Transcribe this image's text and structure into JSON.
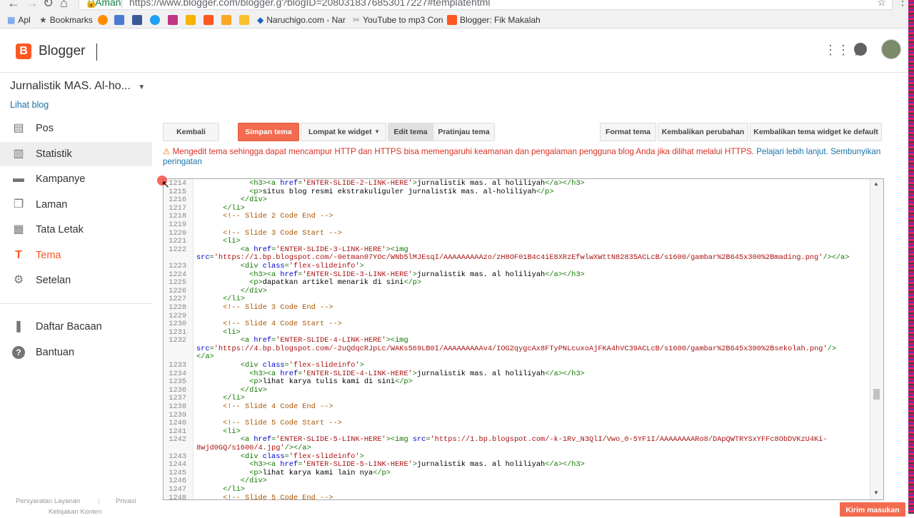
{
  "browser": {
    "url_secure": "Aman",
    "url": "https://www.blogger.com/blogger.g?blogID=2080318376853017227#templatehtml",
    "bookmarks": [
      "Apl",
      "Bookmarks",
      "Naruchigo.com - Nar",
      "YouTube to mp3 Con",
      "Blogger: Fik Makalah"
    ]
  },
  "header": {
    "app_name": "Blogger"
  },
  "sidebar": {
    "blog_title": "Jurnalistik MAS. Al-ho...",
    "view_blog": "Lihat blog",
    "items": [
      {
        "label": "Pos",
        "icon": "posts-icon",
        "glyph": "▤"
      },
      {
        "label": "Statistik",
        "icon": "stats-icon",
        "glyph": "▥"
      },
      {
        "label": "Kampanye",
        "icon": "campaign-icon",
        "glyph": "▬"
      },
      {
        "label": "Laman",
        "icon": "pages-icon",
        "glyph": "❐"
      },
      {
        "label": "Tata Letak",
        "icon": "layout-icon",
        "glyph": "▦"
      },
      {
        "label": "Tema",
        "icon": "theme-icon",
        "glyph": "T",
        "active": true
      },
      {
        "label": "Setelan",
        "icon": "settings-icon",
        "glyph": "⚙"
      }
    ],
    "items2": [
      {
        "label": "Daftar Bacaan",
        "icon": "bookmark-icon",
        "glyph": "❚"
      },
      {
        "label": "Bantuan",
        "icon": "help-icon",
        "glyph": "?"
      }
    ],
    "footer_terms": "Persyaratan Layanan",
    "footer_privacy": "Privasi",
    "footer_content": "Kebijakan Konten"
  },
  "toolbar": {
    "back": "Kembali",
    "save": "Simpan tema",
    "jump": "Lompat ke widget",
    "edit": "Edit tema",
    "preview": "Pratinjau tema",
    "format": "Format tema",
    "revert": "Kembalikan perubahan",
    "revert_default": "Kembalikan tema widget ke default"
  },
  "warning": {
    "text": "Mengedit tema sehingga dapat mencampur HTTP dan HTTPS bisa memengaruhi keamanan dan pengalaman pengguna blog Anda jika dilihat melalui HTTPS.",
    "learn_more": "Pelajari lebih lanjut.",
    "hide": "Sembunyikan",
    "hide2": "peringatan"
  },
  "feedback": "Kirim masukan",
  "code": [
    {
      "n": "1214",
      "segs": [
        [
          "t",
          "            "
        ],
        [
          "tag",
          "<h3><a "
        ],
        [
          "attr",
          "href"
        ],
        [
          "tag",
          "="
        ],
        [
          "str",
          "'ENTER-SLIDE-2-LINK-HERE'"
        ],
        [
          "tag",
          ">"
        ],
        [
          "t",
          "jurnalistik mas. al holiliyah"
        ],
        [
          "tag",
          "</a></h3>"
        ]
      ]
    },
    {
      "n": "1215",
      "segs": [
        [
          "t",
          "            "
        ],
        [
          "tag",
          "<p>"
        ],
        [
          "t",
          "situs blog resmi ekstrakuliguler jurnalistik mas. al-holiliyah"
        ],
        [
          "tag",
          "</p>"
        ]
      ]
    },
    {
      "n": "1216",
      "segs": [
        [
          "t",
          "          "
        ],
        [
          "tag",
          "</div>"
        ]
      ]
    },
    {
      "n": "1217",
      "segs": [
        [
          "t",
          "      "
        ],
        [
          "tag",
          "</li>"
        ]
      ]
    },
    {
      "n": "1218",
      "segs": [
        [
          "t",
          "      "
        ],
        [
          "com",
          "<!-- Slide 2 Code End -->"
        ]
      ]
    },
    {
      "n": "1219",
      "segs": []
    },
    {
      "n": "1220",
      "segs": [
        [
          "t",
          "      "
        ],
        [
          "com",
          "<!-- Slide 3 Code Start -->"
        ]
      ]
    },
    {
      "n": "1221",
      "segs": [
        [
          "t",
          "      "
        ],
        [
          "tag",
          "<li>"
        ]
      ]
    },
    {
      "n": "1222",
      "segs": [
        [
          "t",
          "          "
        ],
        [
          "tag",
          "<a "
        ],
        [
          "attr",
          "href"
        ],
        [
          "tag",
          "="
        ],
        [
          "str",
          "'ENTER-SLIDE-3-LINK-HERE'"
        ],
        [
          "tag",
          "><img"
        ]
      ]
    },
    {
      "n": "",
      "segs": [
        [
          "attr",
          "src"
        ],
        [
          "tag",
          "="
        ],
        [
          "str",
          "'https://1.bp.blogspot.com/-0etman07YOc/WNb5lMJEsqI/AAAAAAAAAzo/zH8OF01B4c4iE8XRzEfwlwXWttN82835ACLcB/s1600/gambar%2B645x300%2Bmading.png'"
        ],
        [
          "tag",
          "/></a>"
        ]
      ],
      "wrap": true
    },
    {
      "n": "1223",
      "segs": [
        [
          "t",
          "          "
        ],
        [
          "tag",
          "<div "
        ],
        [
          "attr",
          "class"
        ],
        [
          "tag",
          "="
        ],
        [
          "str",
          "'flex-slideinfo'"
        ],
        [
          "tag",
          ">"
        ]
      ]
    },
    {
      "n": "1224",
      "segs": [
        [
          "t",
          "            "
        ],
        [
          "tag",
          "<h3><a "
        ],
        [
          "attr",
          "href"
        ],
        [
          "tag",
          "="
        ],
        [
          "str",
          "'ENTER-SLIDE-3-LINK-HERE'"
        ],
        [
          "tag",
          ">"
        ],
        [
          "t",
          "jurnalistik mas. al holiliyah"
        ],
        [
          "tag",
          "</a></h3>"
        ]
      ]
    },
    {
      "n": "1225",
      "segs": [
        [
          "t",
          "            "
        ],
        [
          "tag",
          "<p>"
        ],
        [
          "t",
          "dapatkan artikel menarik di sini"
        ],
        [
          "tag",
          "</p>"
        ]
      ]
    },
    {
      "n": "1226",
      "segs": [
        [
          "t",
          "          "
        ],
        [
          "tag",
          "</div>"
        ]
      ]
    },
    {
      "n": "1227",
      "segs": [
        [
          "t",
          "      "
        ],
        [
          "tag",
          "</li>"
        ]
      ]
    },
    {
      "n": "1228",
      "segs": [
        [
          "t",
          "      "
        ],
        [
          "com",
          "<!-- Slide 3 Code End -->"
        ]
      ]
    },
    {
      "n": "1229",
      "segs": []
    },
    {
      "n": "1230",
      "segs": [
        [
          "t",
          "      "
        ],
        [
          "com",
          "<!-- Slide 4 Code Start -->"
        ]
      ]
    },
    {
      "n": "1231",
      "segs": [
        [
          "t",
          "      "
        ],
        [
          "tag",
          "<li>"
        ]
      ]
    },
    {
      "n": "1232",
      "segs": [
        [
          "t",
          "          "
        ],
        [
          "tag",
          "<a "
        ],
        [
          "attr",
          "href"
        ],
        [
          "tag",
          "="
        ],
        [
          "str",
          "'ENTER-SLIDE-4-LINK-HERE'"
        ],
        [
          "tag",
          "><img"
        ]
      ]
    },
    {
      "n": "",
      "segs": [
        [
          "attr",
          "src"
        ],
        [
          "tag",
          "="
        ],
        [
          "str",
          "'https://4.bp.blogspot.com/-2uQdqcRJpLc/WAKs569LB0I/AAAAAAAAAv4/IOG2qygcAx8FTyPNLcuxoAjFKA4hVC39ACLcB/s1600/gambar%2B645x300%2Bsekolah.png'"
        ],
        [
          "tag",
          "/>"
        ]
      ],
      "wrap": true
    },
    {
      "n": "",
      "segs": [
        [
          "tag",
          "</a>"
        ]
      ],
      "wrap": true
    },
    {
      "n": "1233",
      "segs": [
        [
          "t",
          "          "
        ],
        [
          "tag",
          "<div "
        ],
        [
          "attr",
          "class"
        ],
        [
          "tag",
          "="
        ],
        [
          "str",
          "'flex-slideinfo'"
        ],
        [
          "tag",
          ">"
        ]
      ]
    },
    {
      "n": "1234",
      "segs": [
        [
          "t",
          "            "
        ],
        [
          "tag",
          "<h3><a "
        ],
        [
          "attr",
          "href"
        ],
        [
          "tag",
          "="
        ],
        [
          "str",
          "'ENTER-SLIDE-4-LINK-HERE'"
        ],
        [
          "tag",
          ">"
        ],
        [
          "t",
          "jurnalistik mas. al holiliyah"
        ],
        [
          "tag",
          "</a></h3>"
        ]
      ]
    },
    {
      "n": "1235",
      "segs": [
        [
          "t",
          "            "
        ],
        [
          "tag",
          "<p>"
        ],
        [
          "t",
          "lihat karya tulis kami di sini"
        ],
        [
          "tag",
          "</p>"
        ]
      ]
    },
    {
      "n": "1236",
      "segs": [
        [
          "t",
          "          "
        ],
        [
          "tag",
          "</div>"
        ]
      ]
    },
    {
      "n": "1237",
      "segs": [
        [
          "t",
          "      "
        ],
        [
          "tag",
          "</li>"
        ]
      ]
    },
    {
      "n": "1238",
      "segs": [
        [
          "t",
          "      "
        ],
        [
          "com",
          "<!-- Slide 4 Code End -->"
        ]
      ]
    },
    {
      "n": "1239",
      "segs": []
    },
    {
      "n": "1240",
      "segs": [
        [
          "t",
          "      "
        ],
        [
          "com",
          "<!-- Slide 5 Code Start -->"
        ]
      ]
    },
    {
      "n": "1241",
      "segs": [
        [
          "t",
          "      "
        ],
        [
          "tag",
          "<li>"
        ]
      ]
    },
    {
      "n": "1242",
      "segs": [
        [
          "t",
          "          "
        ],
        [
          "tag",
          "<a "
        ],
        [
          "attr",
          "href"
        ],
        [
          "tag",
          "="
        ],
        [
          "str",
          "'ENTER-SLIDE-5-LINK-HERE'"
        ],
        [
          "tag",
          "><img "
        ],
        [
          "attr",
          "src"
        ],
        [
          "tag",
          "="
        ],
        [
          "str",
          "'https://1.bp.blogspot.com/-k-1Rv_N3QlI/Vwo_0-5YF1I/AAAAAAAARo8/DApQWTRYSxYFFc8ObDVKzU4Ki-"
        ]
      ]
    },
    {
      "n": "",
      "segs": [
        [
          "str",
          "8wjd0GQ/s1600/4.jpg'"
        ],
        [
          "tag",
          "/></a>"
        ]
      ],
      "wrap": true
    },
    {
      "n": "1243",
      "segs": [
        [
          "t",
          "          "
        ],
        [
          "tag",
          "<div "
        ],
        [
          "attr",
          "class"
        ],
        [
          "tag",
          "="
        ],
        [
          "str",
          "'flex-slideinfo'"
        ],
        [
          "tag",
          ">"
        ]
      ]
    },
    {
      "n": "1244",
      "segs": [
        [
          "t",
          "            "
        ],
        [
          "tag",
          "<h3><a "
        ],
        [
          "attr",
          "href"
        ],
        [
          "tag",
          "="
        ],
        [
          "str",
          "'ENTER-SLIDE-5-LINK-HERE'"
        ],
        [
          "tag",
          ">"
        ],
        [
          "t",
          "jurnalistik mas. al holiliyah"
        ],
        [
          "tag",
          "</a></h3>"
        ]
      ]
    },
    {
      "n": "1245",
      "segs": [
        [
          "t",
          "            "
        ],
        [
          "tag",
          "<p>"
        ],
        [
          "t",
          "lihat karya kami lain nya"
        ],
        [
          "tag",
          "</p>"
        ]
      ]
    },
    {
      "n": "1246",
      "segs": [
        [
          "t",
          "          "
        ],
        [
          "tag",
          "</div>"
        ]
      ]
    },
    {
      "n": "1247",
      "segs": [
        [
          "t",
          "      "
        ],
        [
          "tag",
          "</li>"
        ]
      ]
    },
    {
      "n": "1248",
      "segs": [
        [
          "t",
          "      "
        ],
        [
          "com",
          "<!-- Slide 5 Code End -->"
        ]
      ]
    }
  ],
  "colors": {
    "brand": "#ff5722",
    "primary_button": "#f26b4f",
    "warning_text": "#d93025",
    "link": "#1a73a8"
  }
}
